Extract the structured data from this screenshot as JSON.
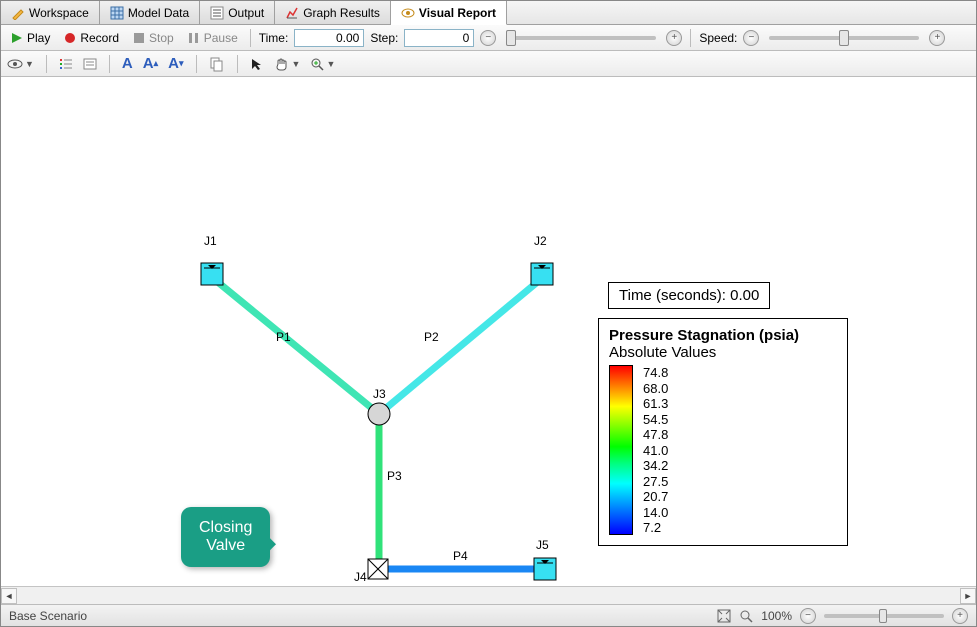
{
  "tabs": {
    "workspace": "Workspace",
    "model_data": "Model Data",
    "output": "Output",
    "graph_results": "Graph Results",
    "visual_report": "Visual Report"
  },
  "playback": {
    "play": "Play",
    "record": "Record",
    "stop": "Stop",
    "pause": "Pause",
    "time_label": "Time:",
    "time_value": "0.00",
    "step_label": "Step:",
    "step_value": "0",
    "speed_label": "Speed:"
  },
  "diagram": {
    "j1": "J1",
    "j2": "J2",
    "j3": "J3",
    "j4": "J4",
    "j5": "J5",
    "p1": "P1",
    "p2": "P2",
    "p3": "P3",
    "p4": "P4"
  },
  "callout": {
    "line1": "Closing",
    "line2": "Valve"
  },
  "time_readout": "Time (seconds): 0.00",
  "legend": {
    "title": "Pressure Stagnation (psia)",
    "subtitle": "Absolute Values",
    "values": [
      "74.8",
      "68.0",
      "61.3",
      "54.5",
      "47.8",
      "41.0",
      "34.2",
      "27.5",
      "20.7",
      "14.0",
      "7.2"
    ]
  },
  "status": {
    "scenario": "Base Scenario",
    "zoom": "100%"
  },
  "chart_data": {
    "type": "network-diagram",
    "title": "Pressure Stagnation (psia) — Absolute Values",
    "time_seconds": 0.0,
    "color_scale": {
      "unit": "psia",
      "min": 7.2,
      "max": 74.8,
      "ticks": [
        74.8,
        68.0,
        61.3,
        54.5,
        47.8,
        41.0,
        34.2,
        27.5,
        20.7,
        14.0,
        7.2
      ]
    },
    "junctions": [
      {
        "id": "J1",
        "type": "reservoir"
      },
      {
        "id": "J2",
        "type": "reservoir"
      },
      {
        "id": "J3",
        "type": "branch"
      },
      {
        "id": "J4",
        "type": "valve",
        "annotation": "Closing Valve"
      },
      {
        "id": "J5",
        "type": "reservoir"
      }
    ],
    "pipes": [
      {
        "id": "P1",
        "from": "J1",
        "to": "J3"
      },
      {
        "id": "P2",
        "from": "J2",
        "to": "J3"
      },
      {
        "id": "P3",
        "from": "J3",
        "to": "J4"
      },
      {
        "id": "P4",
        "from": "J4",
        "to": "J5"
      }
    ]
  }
}
